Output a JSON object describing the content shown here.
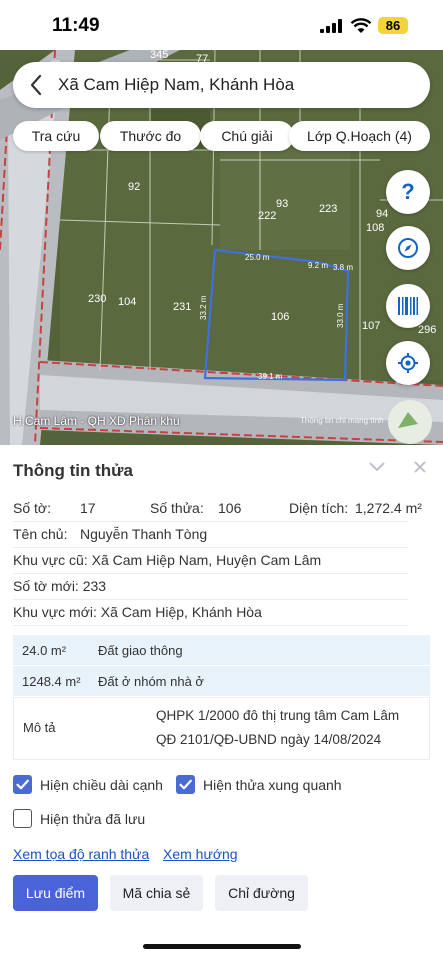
{
  "status": {
    "time": "11:49",
    "battery": "86"
  },
  "header": {
    "title": "Xã Cam Hiệp Nam, Khánh Hòa"
  },
  "chips": [
    "Tra cứu",
    "Thước đo",
    "Chú giải",
    "Lớp Q.Hoạch (4)"
  ],
  "map": {
    "caption": "H.Cam Lâm - QH XD Phân khu",
    "attribution": "Thông tin chi mang tính",
    "parcel_numbers": [
      "92",
      "93",
      "222",
      "223",
      "94",
      "108",
      "345",
      "77",
      "230",
      "104",
      "231",
      "106",
      "107",
      "296"
    ],
    "edge_lengths": [
      "25.0 m",
      "9.2 m",
      "3.8 m",
      "33.2 m",
      "33.0 m",
      "39.1 m"
    ],
    "help_label": "?"
  },
  "panel": {
    "title": "Thông tin thửa",
    "so_to_label": "Số tờ:",
    "so_to_value": "17",
    "so_thua_label": "Số thửa:",
    "so_thua_value": "106",
    "dien_tich_label": "Diện tích:",
    "dien_tich_value": "1,272.4 m²",
    "ten_chu_label": "Tên chủ:",
    "ten_chu_value": "Nguyễn Thanh Tòng",
    "khu_vuc_cu": "Khu vực cũ: Xã Cam Hiệp Nam, Huyện Cam Lâm",
    "so_to_moi": "Số tờ mới: 233",
    "khu_vuc_moi": "Khu vực mới: Xã Cam Hiệp, Khánh Hòa"
  },
  "land_use": [
    {
      "area": "24.0 m²",
      "type": "Đất giao thông"
    },
    {
      "area": "1248.4 m²",
      "type": "Đất ở nhóm nhà ở"
    }
  ],
  "description": {
    "label": "Mô tả",
    "line1": "QHPK 1/2000 đô thị trung tâm Cam Lâm",
    "line2": "QĐ 2101/QĐ-UBND ngày 14/08/2024"
  },
  "options": {
    "show_edge_length": "Hiện chiều dài cạnh",
    "show_neighbors": "Hiện thửa xung quanh",
    "show_saved": "Hiện thửa đã lưu"
  },
  "links": {
    "boundary_coords": "Xem tọa độ ranh thửa",
    "direction": "Xem hướng"
  },
  "buttons": {
    "save": "Lưu điểm",
    "share": "Mã chia sẻ",
    "route": "Chỉ đường"
  },
  "colors": {
    "accent": "#4a63d8",
    "link": "#1a52c4",
    "parcel": "#3f6fe0"
  }
}
